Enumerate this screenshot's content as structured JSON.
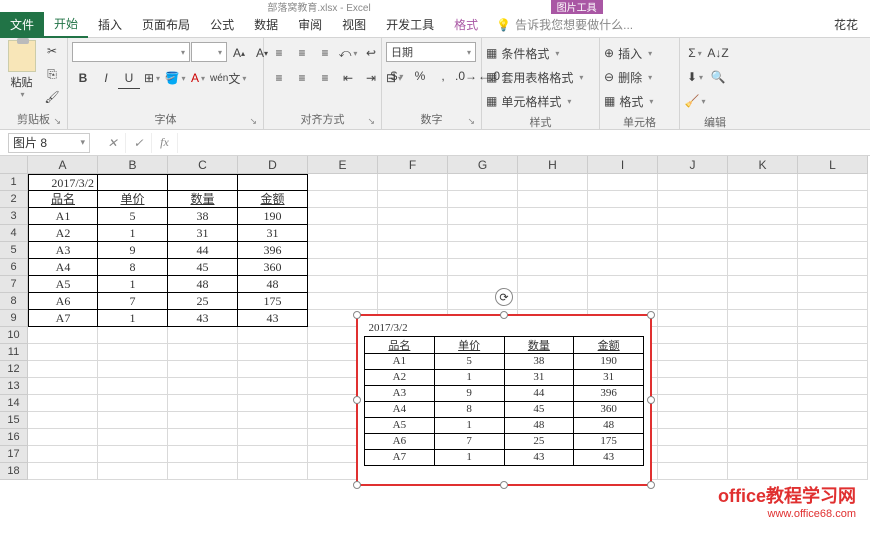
{
  "titlebar": {
    "doc": "部落窝教育.xlsx - Excel",
    "contextual": "图片工具"
  },
  "tabs": {
    "file": "文件",
    "home": "开始",
    "insert": "插入",
    "layout": "页面布局",
    "formulas": "公式",
    "data": "数据",
    "review": "审阅",
    "view": "视图",
    "dev": "开发工具",
    "format": "格式",
    "tellme": "告诉我您想要做什么...",
    "user": "花花"
  },
  "ribbon": {
    "clipboard": {
      "paste": "粘贴",
      "label": "剪贴板"
    },
    "font": {
      "label": "字体",
      "bold": "B",
      "italic": "I",
      "underline": "U"
    },
    "alignment": {
      "label": "对齐方式"
    },
    "number": {
      "label": "数字",
      "format": "日期"
    },
    "styles": {
      "label": "样式",
      "cond": "条件格式",
      "table": "套用表格格式",
      "cell": "单元格样式"
    },
    "cells": {
      "label": "单元格",
      "insert": "插入",
      "delete": "删除",
      "format": "格式"
    },
    "editing": {
      "label": "编辑"
    }
  },
  "namebox": "图片 8",
  "columns": [
    "A",
    "B",
    "C",
    "D",
    "E",
    "F",
    "G",
    "H",
    "I",
    "J",
    "K",
    "L"
  ],
  "rows": [
    "1",
    "2",
    "3",
    "4",
    "5",
    "6",
    "7",
    "8",
    "9",
    "10",
    "11",
    "12",
    "13",
    "14",
    "15",
    "16",
    "17",
    "18"
  ],
  "table": {
    "date": "2017/3/2",
    "headers": [
      "品名",
      "单价",
      "数量",
      "金额"
    ],
    "data": [
      [
        "A1",
        "5",
        "38",
        "190"
      ],
      [
        "A2",
        "1",
        "31",
        "31"
      ],
      [
        "A3",
        "9",
        "44",
        "396"
      ],
      [
        "A4",
        "8",
        "45",
        "360"
      ],
      [
        "A5",
        "1",
        "48",
        "48"
      ],
      [
        "A6",
        "7",
        "25",
        "175"
      ],
      [
        "A7",
        "1",
        "43",
        "43"
      ]
    ]
  },
  "watermark": {
    "line1": "office教程学习网",
    "line2": "www.office68.com"
  }
}
